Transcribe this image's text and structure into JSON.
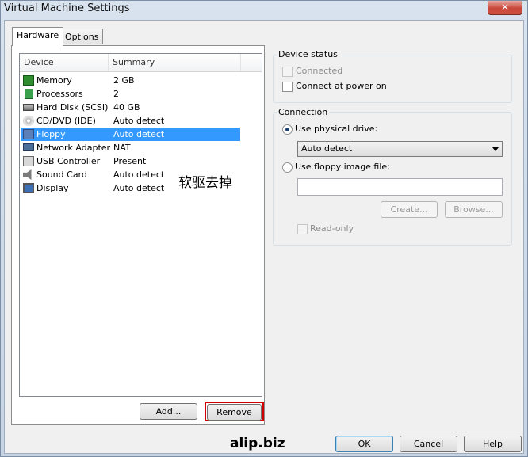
{
  "window": {
    "title": "Virtual Machine Settings",
    "close_glyph": "✕"
  },
  "tabs": [
    {
      "label": "Hardware",
      "active": true
    },
    {
      "label": "Options",
      "active": false
    }
  ],
  "device_list": {
    "columns": [
      "Device",
      "Summary"
    ],
    "rows": [
      {
        "device": "Memory",
        "summary": "2 GB",
        "icon": "memory-icon"
      },
      {
        "device": "Processors",
        "summary": "2",
        "icon": "processor-icon"
      },
      {
        "device": "Hard Disk (SCSI)",
        "summary": "40 GB",
        "icon": "hard-disk-icon"
      },
      {
        "device": "CD/DVD (IDE)",
        "summary": "Auto detect",
        "icon": "cd-dvd-icon"
      },
      {
        "device": "Floppy",
        "summary": "Auto detect",
        "icon": "floppy-icon",
        "selected": true
      },
      {
        "device": "Network Adapter",
        "summary": "NAT",
        "icon": "network-adapter-icon"
      },
      {
        "device": "USB Controller",
        "summary": "Present",
        "icon": "usb-icon"
      },
      {
        "device": "Sound Card",
        "summary": "Auto detect",
        "icon": "sound-card-icon"
      },
      {
        "device": "Display",
        "summary": "Auto detect",
        "icon": "display-icon"
      }
    ],
    "selected_color": "#3399ff"
  },
  "overlay_annotation": "软驱去掉",
  "list_buttons": {
    "add": "Add...",
    "remove": "Remove"
  },
  "device_status": {
    "title": "Device status",
    "connected": {
      "label": "Connected",
      "checked": false,
      "enabled": false
    },
    "connect_at_power_on": {
      "label": "Connect at power on",
      "checked": false,
      "enabled": true
    }
  },
  "connection": {
    "title": "Connection",
    "physical_drive": {
      "label": "Use physical drive:",
      "selected": true
    },
    "drive_select": {
      "value": "Auto detect"
    },
    "image_file": {
      "label": "Use floppy image file:",
      "selected": false,
      "value": ""
    },
    "create_button": "Create...",
    "browse_button": "Browse...",
    "read_only": {
      "label": "Read-only",
      "checked": false,
      "enabled": false
    }
  },
  "footer": {
    "ok": "OK",
    "cancel": "Cancel",
    "help": "Help"
  },
  "watermark": "alip.biz"
}
